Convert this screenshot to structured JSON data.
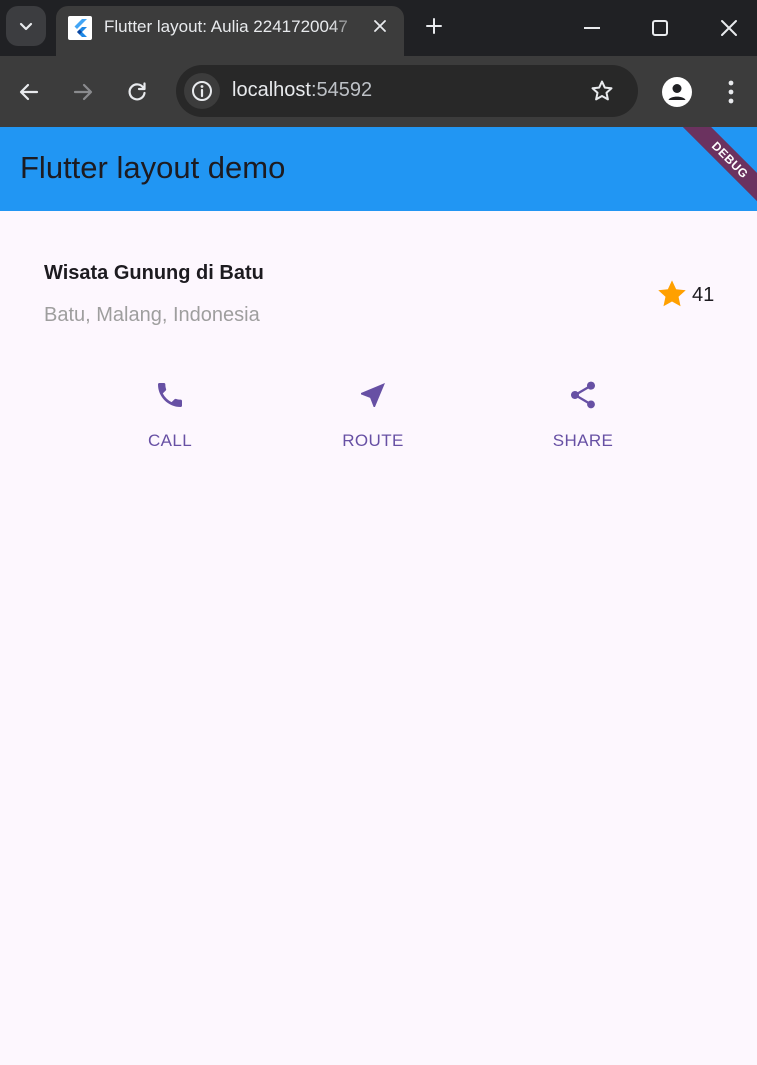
{
  "browser": {
    "tab_title": "Flutter layout: Aulia 2241720047",
    "url_host": "localhost",
    "url_port": ":54592",
    "icons": {
      "tab_search": "chevron-down-icon",
      "favicon": "flutter-logo-icon",
      "tab_close": "close-icon",
      "new_tab": "plus-icon",
      "minimize": "minimize-icon",
      "maximize": "maximize-icon",
      "close_window": "close-icon",
      "back": "arrow-left-icon",
      "forward": "arrow-right-icon",
      "reload": "reload-icon",
      "site_info": "info-icon",
      "bookmark": "star-outline-icon",
      "profile": "person-icon",
      "menu": "kebab-menu-icon"
    },
    "colors": {
      "tabstrip": "#202124",
      "toolbar": "#3c3c3c",
      "omnibox": "#282828"
    }
  },
  "app": {
    "appbar_title": "Flutter layout demo",
    "debug_banner": "DEBUG",
    "place_name": "Wisata Gunung di Batu",
    "place_location": "Batu, Malang, Indonesia",
    "rating_count": "41",
    "actions": [
      {
        "label": "CALL",
        "icon": "phone-icon"
      },
      {
        "label": "ROUTE",
        "icon": "near-me-icon"
      },
      {
        "label": "SHARE",
        "icon": "share-icon"
      }
    ],
    "colors": {
      "appbar": "#2196f3",
      "background": "#fdf7fe",
      "accent": "#6750a4",
      "star": "#ffa000",
      "location_text": "#9e9e9e"
    }
  }
}
